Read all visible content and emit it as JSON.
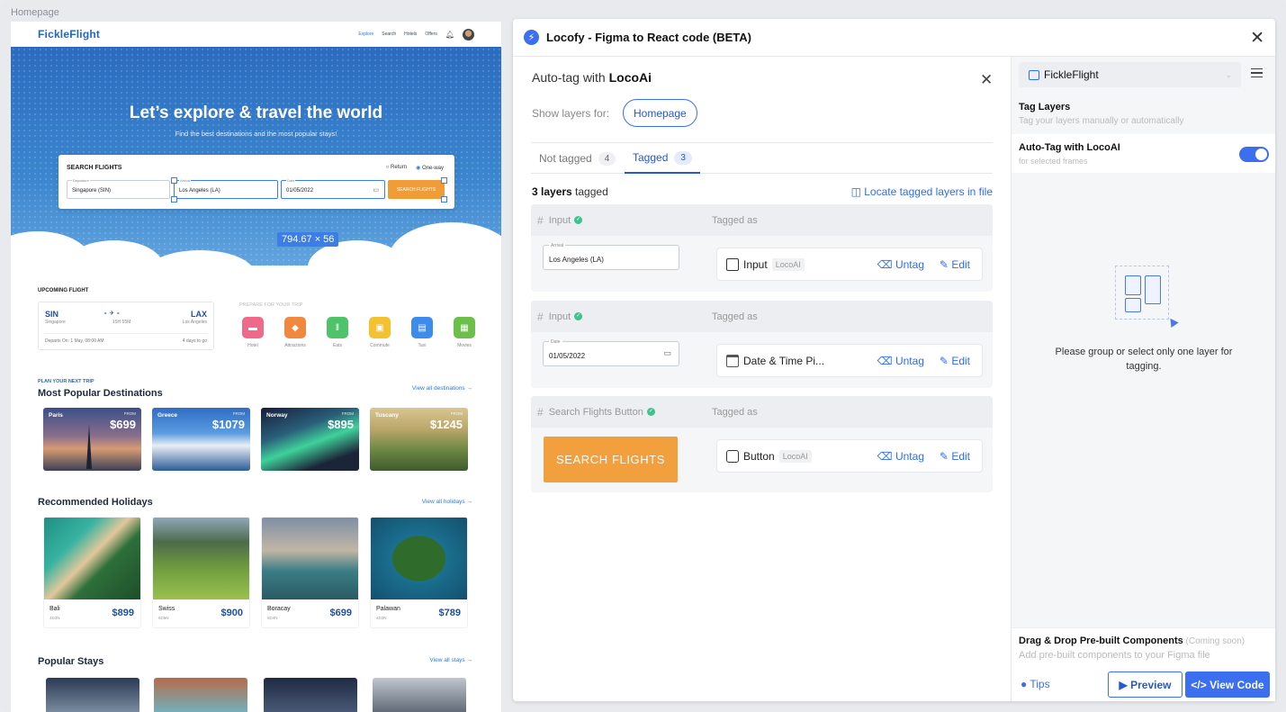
{
  "frame_label": "Homepage",
  "site": {
    "logo": "FickleFlight",
    "nav": [
      "Explore",
      "Search",
      "Hotels",
      "Offers"
    ],
    "hero_title": "Let’s explore & travel the world",
    "hero_sub": "Find the best destinations and the most popular stays!",
    "search": {
      "title": "SEARCH FLIGHTS",
      "return": "Return",
      "oneway": "One-way",
      "departure_label": "Departure",
      "departure": "Singapore (SIN)",
      "arrival_label": "Arrival",
      "arrival": "Los Angeles (LA)",
      "date_label": "Date",
      "date": "01/05/2022",
      "button": "SEARCH FLIGHTS"
    },
    "selection_size": "794.67 × 56",
    "upcoming_title": "UPCOMING FLIGHT",
    "flight": {
      "from": "SIN",
      "from_city": "Singapore",
      "to": "LAX",
      "to_city": "Los Angeles",
      "duration": "15H 55M",
      "departs": "Departs On: 1 May, 08:00 AM",
      "days": "4 days to go"
    },
    "prepare": "PREPARE FOR YOUR TRIP",
    "categories": [
      {
        "label": "Hotel",
        "color": "#ef6a8a",
        "icon": "bed-icon"
      },
      {
        "label": "Attractions",
        "color": "#f0893f",
        "icon": "ticket-icon"
      },
      {
        "label": "Eats",
        "color": "#4fc36a",
        "icon": "cutlery-icon"
      },
      {
        "label": "Commute",
        "color": "#f4c130",
        "icon": "bus-icon"
      },
      {
        "label": "Taxi",
        "color": "#3d8bec",
        "icon": "car-icon"
      },
      {
        "label": "Movies",
        "color": "#6cc04a",
        "icon": "film-icon"
      }
    ],
    "plan_label": "PLAN YOUR NEXT TRIP",
    "popular_title": "Most Popular Destinations",
    "view_all_dest": "View all destinations →",
    "from_label": "FROM",
    "destinations": [
      {
        "name": "Paris",
        "price": "$699"
      },
      {
        "name": "Greece",
        "price": "$1079"
      },
      {
        "name": "Norway",
        "price": "$895"
      },
      {
        "name": "Tuscany",
        "price": "$1245"
      }
    ],
    "holidays_title": "Recommended Holidays",
    "view_all_hol": "View all holidays →",
    "holidays": [
      {
        "name": "Bali",
        "days": "4D3N",
        "price": "$899"
      },
      {
        "name": "Swiss",
        "days": "6D5N",
        "price": "$900"
      },
      {
        "name": "Boracay",
        "days": "5D4N",
        "price": "$699"
      },
      {
        "name": "Palawan",
        "days": "4D3N",
        "price": "$789"
      }
    ],
    "stays_title": "Popular Stays",
    "view_all_stays": "View all stays →"
  },
  "plugin": {
    "title": "Locofy - Figma to React code (BETA)",
    "autotag_prefix": "Auto-tag with ",
    "autotag_name": "LocoAi",
    "show_layers": "Show layers for:",
    "frame_pill": "Homepage",
    "tabs": [
      {
        "label": "Not tagged",
        "count": "4"
      },
      {
        "label": "Tagged",
        "count": "3"
      }
    ],
    "count_bold": "3 layers",
    "count_rest": " tagged",
    "locate": "Locate tagged layers in file",
    "tagged_as": "Tagged as",
    "untag": "Untag",
    "edit": "Edit",
    "layers": [
      {
        "name": "Input",
        "field_label": "Arrival",
        "field_value": "Los Angeles (LA)",
        "tag": "Input",
        "badge": "LocoAI"
      },
      {
        "name": "Input",
        "field_label": "Date",
        "field_value": "01/05/2022",
        "tag": "Date & Time Pi...",
        "badge": ""
      },
      {
        "name": "Search Flights Button",
        "button": "SEARCH FLIGHTS",
        "tag": "Button",
        "badge": "LocoAI"
      }
    ]
  },
  "panel": {
    "project": "FickleFlight",
    "tag_layers": "Tag Layers",
    "tag_layers_desc": "Tag your layers manually or automatically",
    "autotag": "Auto-Tag with LocoAI",
    "autotag_desc": "for selected frames",
    "empty": "Please group or select only one layer for tagging.",
    "dnd": "Drag & Drop Pre-built Components",
    "dnd_soon": " (Coming soon)",
    "dnd_desc": "Add pre-built components to your Figma file",
    "tips": "Tips",
    "preview": "▶ Preview",
    "view_code": "</> View Code"
  }
}
